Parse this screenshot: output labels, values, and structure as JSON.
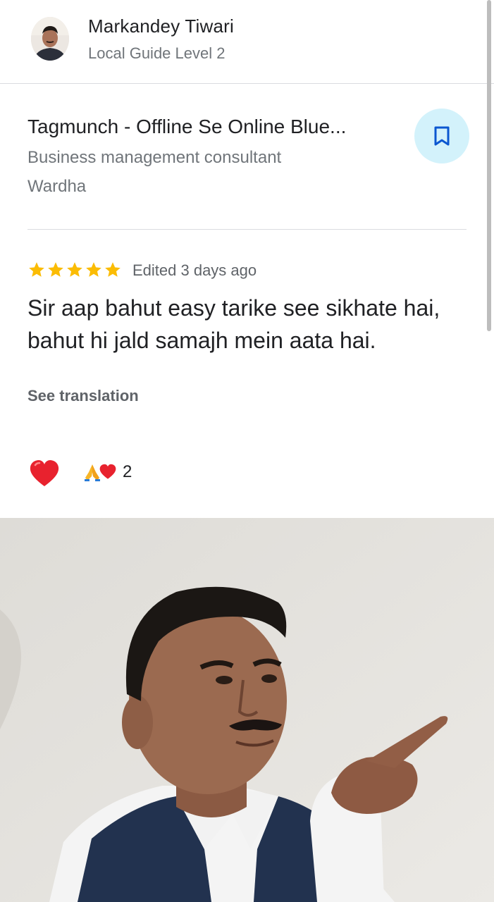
{
  "reviewer": {
    "name": "Markandey Tiwari",
    "level": "Local Guide Level 2"
  },
  "place": {
    "name": "Tagmunch - Offline Se Online Blue...",
    "category": "Business management consultant",
    "city": "Wardha"
  },
  "review": {
    "rating": 5,
    "edited": "Edited 3 days ago",
    "text": "Sir aap bahut easy tarike see sikhate hai, bahut hi jald samajh mein aata hai.",
    "see_translation": "See translation"
  },
  "reactions": {
    "count": "2",
    "icons": [
      "folded-hands-icon",
      "heart-icon"
    ]
  },
  "colors": {
    "star": "#fbbc04",
    "save_bg": "#d3f2fb",
    "save_icon": "#0b57d0",
    "heart": "#e8222e"
  }
}
